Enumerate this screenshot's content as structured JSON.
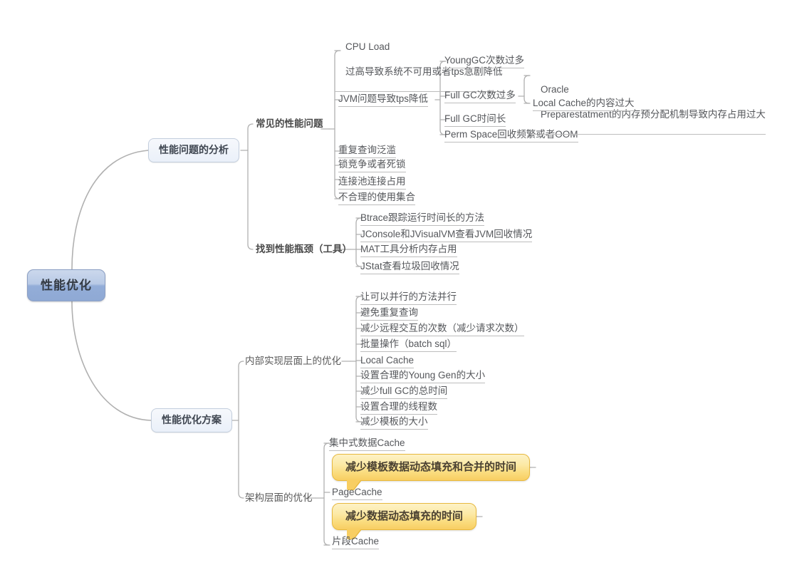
{
  "document": {
    "type": "mindmap",
    "title": "性能优化"
  },
  "root": {
    "label": "性能优化"
  },
  "branches": [
    {
      "label": "性能问题的分析",
      "groups": [
        {
          "label": "常见的性能问题",
          "items": [
            {
              "label": "CPU Load",
              "label2": "过高导致系统不可用或者tps急剧降低"
            },
            {
              "label": "JVM问题导致tps降低",
              "children": [
                {
                  "label": "YoungGC次数过多"
                },
                {
                  "label": "Full GC次数过多",
                  "children": [
                    {
                      "label": "Oracle",
                      "label2": "Preparestatment的内存预分配机制导致内存占用过大"
                    },
                    {
                      "label": "Local Cache的内容过大"
                    }
                  ]
                },
                {
                  "label": "Full GC时间长"
                },
                {
                  "label": "Perm Space回收频繁或者OOM"
                }
              ]
            },
            {
              "label": "重复查询泛滥"
            },
            {
              "label": "锁竞争或者死锁"
            },
            {
              "label": "连接池连接占用"
            },
            {
              "label": "不合理的使用集合"
            }
          ]
        },
        {
          "label": "找到性能瓶颈（工具）",
          "items": [
            {
              "label": "Btrace跟踪运行时间长的方法"
            },
            {
              "label": "JConsole和JVisualVM查看JVM回收情况"
            },
            {
              "label": "MAT工具分析内存占用"
            },
            {
              "label": "JStat查看垃圾回收情况"
            }
          ]
        }
      ]
    },
    {
      "label": "性能优化方案",
      "groups": [
        {
          "label": "内部实现层面上的优化",
          "items": [
            {
              "label": "让可以并行的方法并行"
            },
            {
              "label": "避免重复查询"
            },
            {
              "label": "减少远程交互的次数（减少请求次数）"
            },
            {
              "label": "批量操作（batch sql）"
            },
            {
              "label": "Local Cache"
            },
            {
              "label": "设置合理的Young Gen的大小"
            },
            {
              "label": "减少full GC的总时间"
            },
            {
              "label": "设置合理的线程数"
            },
            {
              "label": "减少模板的大小"
            }
          ]
        },
        {
          "label": "架构层面的优化",
          "items": [
            {
              "label": "集中式数据Cache"
            },
            {
              "label": "减少模板数据动态填充和合并的时间",
              "style": "callout"
            },
            {
              "label": "PageCache"
            },
            {
              "label": "减少数据动态填充的时间",
              "style": "callout"
            },
            {
              "label": "片段Cache"
            }
          ]
        }
      ]
    }
  ],
  "colors": {
    "root_fill_top": "#cbd8ec",
    "root_fill_bottom": "#8fa9d4",
    "root_border": "#8c9fc4",
    "level2_fill": "#eef2fa",
    "level2_border": "#c3cedd",
    "callout_fill_top": "#fdf2c6",
    "callout_fill_bottom": "#f8ce62",
    "callout_border": "#e8b93f",
    "connector": "#b0b0b0",
    "text": "#55575b",
    "background": "#ffffff"
  }
}
